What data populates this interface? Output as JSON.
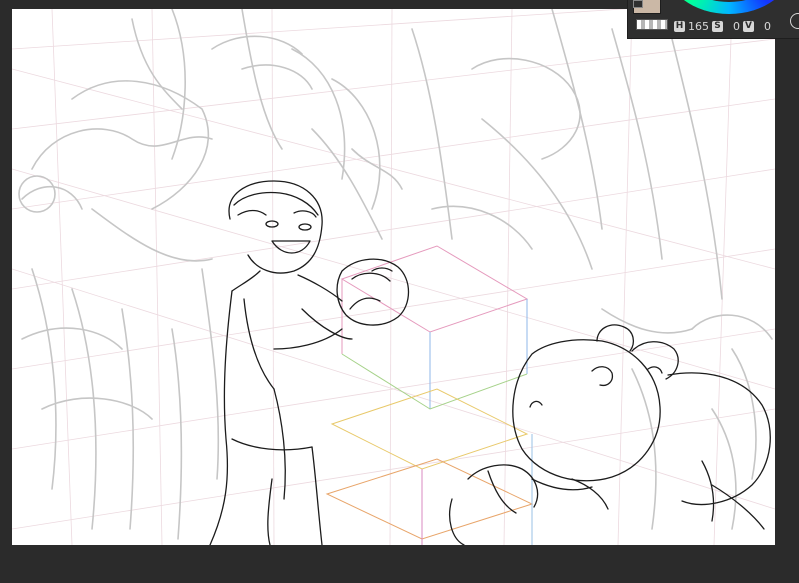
{
  "color_panel": {
    "main_color": "#cbb8a6",
    "hsv": {
      "h_key": "H",
      "h_value": "165",
      "s_key": "S",
      "s_value": "0",
      "v_key": "V",
      "v_value": "0"
    }
  },
  "colors": {
    "canvas_background": "#2b2b2b",
    "paper": "#ffffff",
    "line_art": "#1a1a1a",
    "rough_sketch": "#c9c9c9",
    "perspective_grid": "#e6cfd7"
  },
  "icons": [
    "color-wheel-icon",
    "transparent-color-icon",
    "navigator-icon"
  ]
}
